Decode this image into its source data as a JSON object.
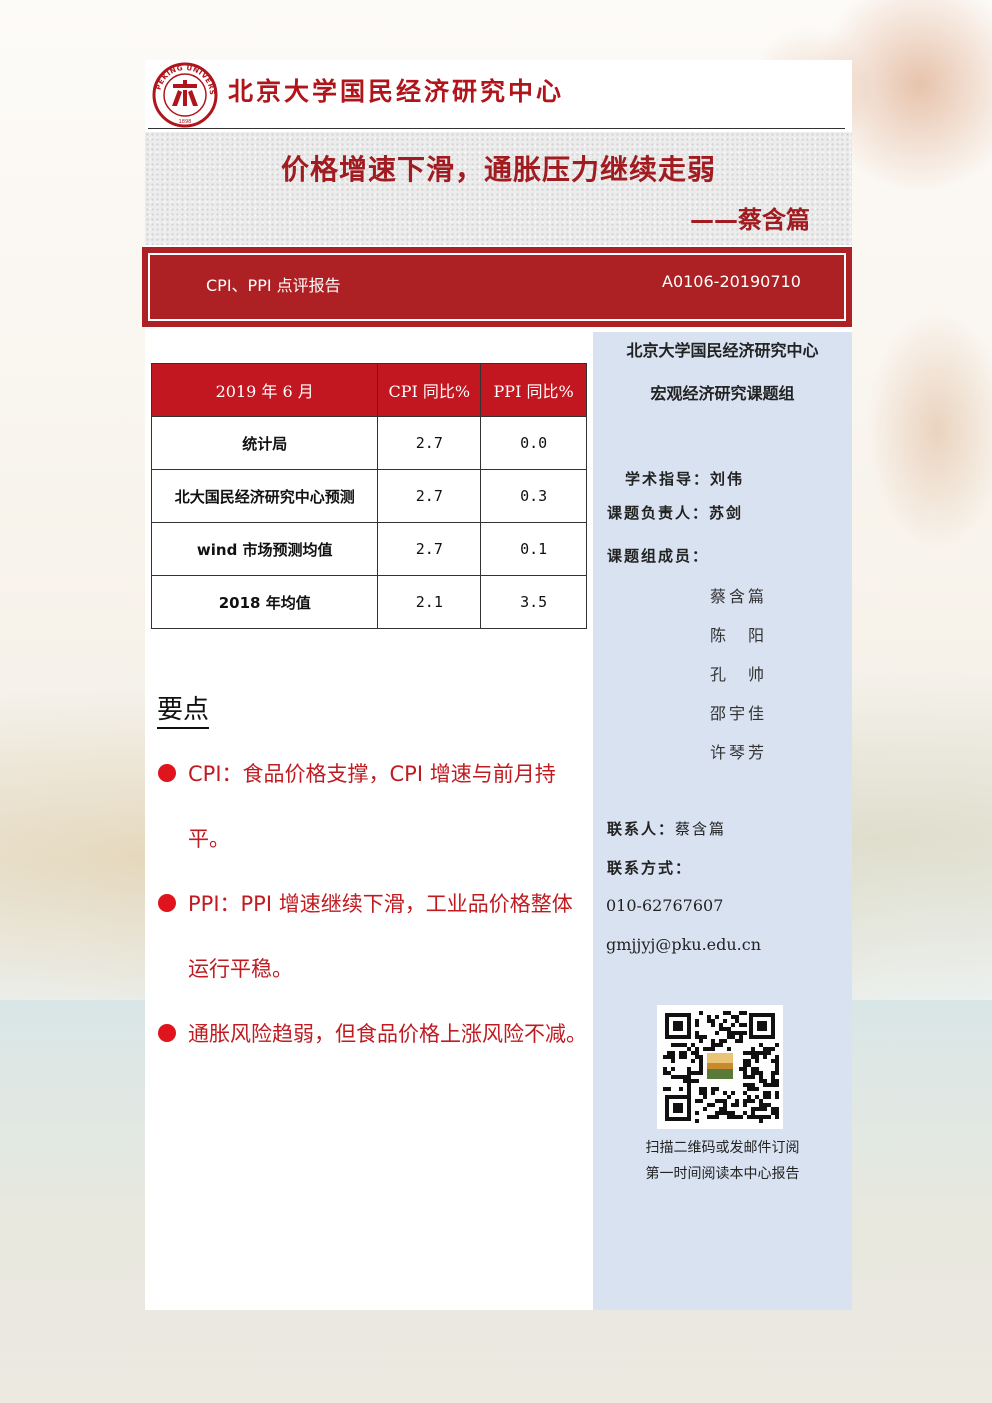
{
  "header": {
    "org_name": "北京大学国民经济研究中心"
  },
  "title": {
    "main": "价格增速下滑，通胀压力继续走弱",
    "author": "——蔡含篇"
  },
  "banner": {
    "report_type": "CPI、PPI 点评报告",
    "report_id": "A0106-20190710"
  },
  "table": {
    "headers": [
      "2019 年 6 月",
      "CPI 同比%",
      "PPI 同比%"
    ],
    "rows": [
      {
        "label": "统计局",
        "cpi": "2.7",
        "ppi": "0.0"
      },
      {
        "label": "北大国民经济研究中心预测",
        "cpi": "2.7",
        "ppi": "0.3"
      },
      {
        "label": "wind 市场预测均值",
        "cpi": "2.7",
        "ppi": "0.1"
      },
      {
        "label": "2018 年均值",
        "cpi": "2.1",
        "ppi": "3.5"
      }
    ]
  },
  "key_points": {
    "heading": "要点",
    "items": [
      "CPI：食品价格支撑，CPI 增速与前月持平。",
      "PPI：PPI 增速继续下滑，工业品价格整体运行平稳。",
      "通胀风险趋弱，但食品价格上涨风险不减。"
    ]
  },
  "sidebar": {
    "org": "北京大学国民经济研究中心",
    "group": "宏观经济研究课题组",
    "advisor_label": "学术指导：",
    "advisor": "刘伟",
    "leader_label": "课题负责人：",
    "leader": "苏剑",
    "members_label": "课题组成员：",
    "members": [
      "蔡含篇",
      "陈　阳",
      "孔　帅",
      "邵宇佳",
      "许琴芳"
    ],
    "contact_label": "联系人：",
    "contact": "蔡含篇",
    "method_label": "联系方式：",
    "phone": "010-62767607",
    "email": "gmjjyj@pku.edu.cn",
    "qr_caption_1": "扫描二维码或发邮件订阅",
    "qr_caption_2": "第一时间阅读本中心报告"
  },
  "logo_text": {
    "ring": "PEKING UNIVERSITY",
    "year": "1898"
  }
}
